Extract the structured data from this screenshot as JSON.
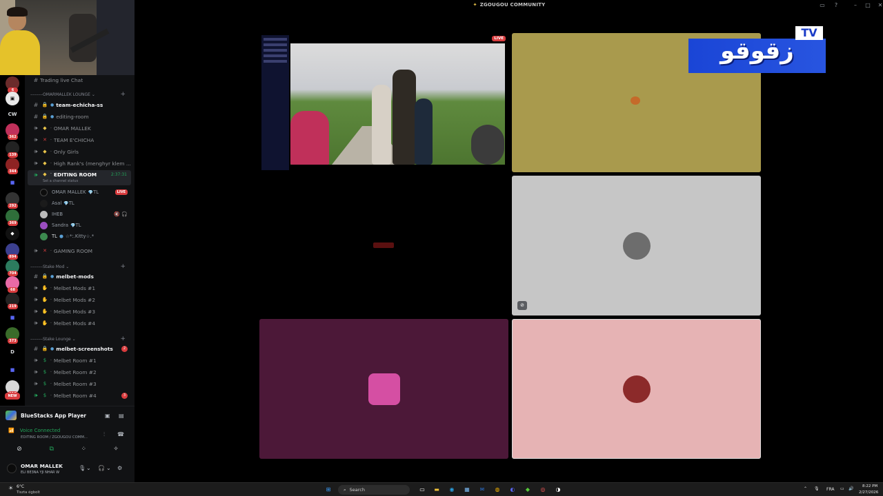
{
  "window": {
    "title": "ZGOUGOU COMMUNITY"
  },
  "channels": {
    "top_label": "Trading live Chat",
    "cat1": "OMARMALLEK LOUNGE",
    "cat2": "Stake Mod",
    "cat3": "Stake Lounge",
    "items": [
      {
        "label": "team-echicha-ss"
      },
      {
        "label": "editing-room"
      },
      {
        "label": "OMAR MALLEK"
      },
      {
        "label": "TEAM E'CHICHA"
      },
      {
        "label": "Only Girls"
      },
      {
        "label": "High Rank's (menghyr klem ..."
      }
    ],
    "selected": {
      "label": "EDITING ROOM",
      "timer": "2:37:31",
      "status": "Set a channel status"
    },
    "voice_users": [
      {
        "name": "OMAR MALLEK",
        "tag": "TL",
        "live": "LIVE"
      },
      {
        "name": "Asal",
        "tag": "TL"
      },
      {
        "name": "IHEB"
      },
      {
        "name": "Sandra",
        "tag": "TL"
      },
      {
        "name": "TL",
        "tag": "☆*:.Kitty☆.*"
      }
    ],
    "gaming": "GAMING ROOM",
    "stake_items": [
      "melbet-mods",
      "Melbet Mods #1",
      "Melbet Mods #2",
      "Melbet Mods #3",
      "Melbet Mods #4"
    ],
    "lounge_items": [
      "melbet-screenshots",
      "Melbet Room #1",
      "Melbet Room #2",
      "Melbet Room #3",
      "Melbet Room #4"
    ],
    "unread_screens": "2",
    "unread_room4": "3"
  },
  "servers": {
    "cw": "CW",
    "d": "D",
    "badges": [
      "6",
      "362",
      "139",
      "344",
      "292",
      "369",
      "894",
      "704",
      "68",
      "219",
      "373",
      "116"
    ],
    "new_label": "NEW"
  },
  "panel": {
    "activity": "BlueStacks App Player",
    "voice_connected": "Voice Connected",
    "voice_sub": "EDITING ROOM / ZGOUGOU COMM...",
    "user_name": "OMAR MALLEK",
    "user_status": "ELI BE3NA YJI NHAR W"
  },
  "stage": {
    "live_badge": "LIVE"
  },
  "logo": {
    "tv": "TV",
    "word": "زقوقو"
  },
  "taskbar": {
    "temp": "6°C",
    "weather": "Tiszta égbolt",
    "search": "Search",
    "lang": "FRA",
    "time": "8:22 PM",
    "date": "2/27/2026"
  },
  "colors": {
    "accent_green": "#23a55a",
    "live_red": "#d83c3e",
    "logo_blue": "#1a45d6"
  }
}
